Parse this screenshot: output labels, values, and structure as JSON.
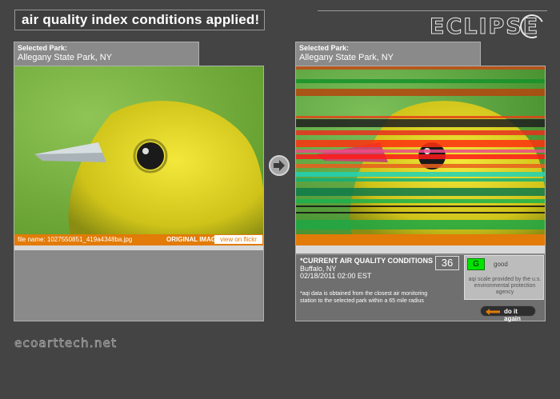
{
  "header": {
    "title": "air quality index conditions applied!",
    "logo_text": "ECLIPSE"
  },
  "left_panel": {
    "park_label": "Selected Park:",
    "park_name": "Allegany State Park, NY",
    "file_name": "file name: 1027550851_419a4348ba.jpg",
    "image_label": "ORIGINAL IMAGE",
    "flickr_button": "view on flickr"
  },
  "right_panel": {
    "park_label": "Selected Park:",
    "park_name": "Allegany State Park, NY",
    "aq_title": "*CURRENT AIR QUALITY CONDITIONS",
    "aq_city": "Buffalo, NY",
    "aq_date": "02/18/2011 02:00 EST",
    "aqi_value": "36",
    "aqi_letter": "G",
    "aqi_category": "good",
    "scale_note": "aqi scale provided by the u.s. environmental protection agency",
    "aq_note": "*aqi data is obtained from the closest air monitoring station to the selected park within a 65 mile radius",
    "again_button": "do it again"
  },
  "footer": {
    "site": "ecoarttech.net"
  },
  "colors": {
    "accent_orange": "#e27b07",
    "aqi_good": "#00e400",
    "background": "#444444"
  }
}
